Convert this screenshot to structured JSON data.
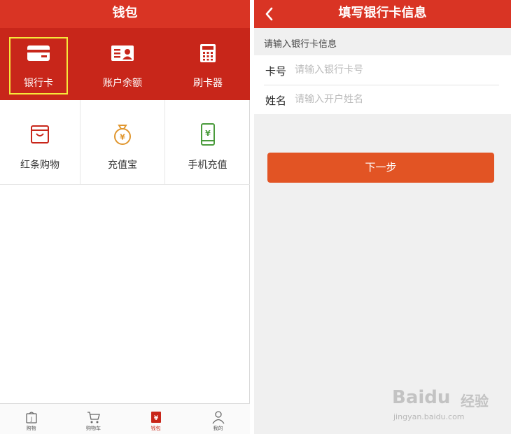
{
  "left": {
    "title": "钱包",
    "top_items": [
      {
        "label": "银行卡",
        "icon": "card-icon"
      },
      {
        "label": "账户余额",
        "icon": "account-balance-icon"
      },
      {
        "label": "刷卡器",
        "icon": "card-reader-icon"
      }
    ],
    "grid_items": [
      {
        "label": "红条购物",
        "icon": "shopping-bag-icon"
      },
      {
        "label": "充值宝",
        "icon": "money-bag-icon"
      },
      {
        "label": "手机充值",
        "icon": "phone-recharge-icon"
      }
    ],
    "tabs": [
      {
        "label": "购物",
        "icon": "shopping-icon"
      },
      {
        "label": "购物车",
        "icon": "cart-icon"
      },
      {
        "label": "钱包",
        "icon": "wallet-icon",
        "active": true
      },
      {
        "label": "我的",
        "icon": "user-icon"
      }
    ]
  },
  "right": {
    "title": "填写银行卡信息",
    "section_hint": "请输入银行卡信息",
    "card_no_label": "卡号",
    "card_no_placeholder": "请输入银行卡号",
    "name_label": "姓名",
    "name_placeholder": "请输入开户姓名",
    "next_label": "下一步"
  },
  "watermark": {
    "brand": "Baidu",
    "cn": "经验",
    "url": "jingyan.baidu.com"
  },
  "colors": {
    "header_red": "#d93424",
    "panel_red": "#c8261a",
    "button_orange": "#e25424",
    "highlight_yellow": "#f6e83a"
  }
}
